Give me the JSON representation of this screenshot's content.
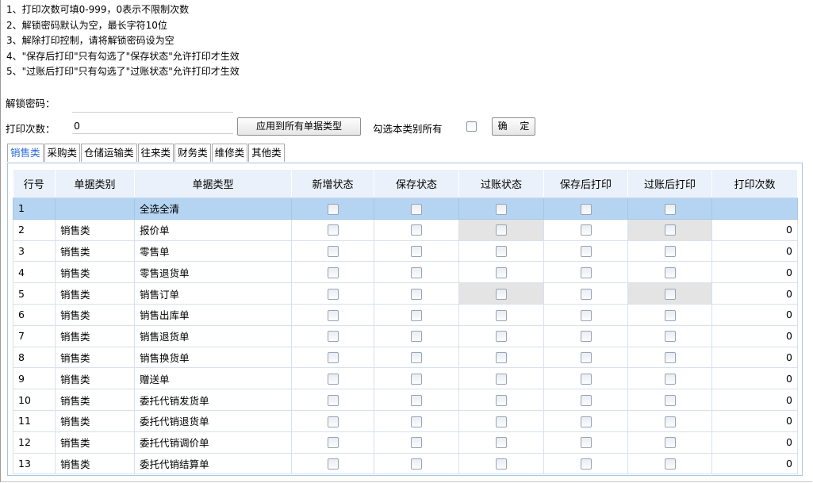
{
  "notes": [
    "1、打印次数可填0-999，0表示不限制次数",
    "2、解锁密码默认为空，最长字符10位",
    "3、解除打印控制，请将解锁密码设为空",
    "4、\"保存后打印\"只有勾选了\"保存状态\"允许打印才生效",
    "5、\"过账后打印\"只有勾选了\"过账状态\"允许打印才生效"
  ],
  "unlock_password": {
    "label": "解锁密码：",
    "value": ""
  },
  "print_count": {
    "label": "打印次数：",
    "value": "0"
  },
  "apply_button": "应用到所有单据类型",
  "select_all_label": "勾选本类别所有",
  "confirm_button": "确 定",
  "tabs": [
    "销售类",
    "采购类",
    "仓储运输类",
    "往来类",
    "财务类",
    "维修类",
    "其他类"
  ],
  "active_tab": 0,
  "table": {
    "headers": [
      "行号",
      "单据类别",
      "单据类型",
      "新增状态",
      "保存状态",
      "过账状态",
      "保存后打印",
      "过账后打印",
      "打印次数"
    ],
    "rows": [
      {
        "no": "1",
        "category": "",
        "type": "全选全清",
        "count": "",
        "selected": true,
        "gray": []
      },
      {
        "no": "2",
        "category": "销售类",
        "type": "报价单",
        "count": "0",
        "selected": false,
        "gray": [
          2,
          4
        ]
      },
      {
        "no": "3",
        "category": "销售类",
        "type": "零售单",
        "count": "0",
        "selected": false,
        "gray": []
      },
      {
        "no": "4",
        "category": "销售类",
        "type": "零售退货单",
        "count": "0",
        "selected": false,
        "gray": []
      },
      {
        "no": "5",
        "category": "销售类",
        "type": "销售订单",
        "count": "0",
        "selected": false,
        "gray": [
          2,
          4
        ]
      },
      {
        "no": "6",
        "category": "销售类",
        "type": "销售出库单",
        "count": "0",
        "selected": false,
        "gray": []
      },
      {
        "no": "7",
        "category": "销售类",
        "type": "销售退货单",
        "count": "0",
        "selected": false,
        "gray": []
      },
      {
        "no": "8",
        "category": "销售类",
        "type": "销售换货单",
        "count": "0",
        "selected": false,
        "gray": []
      },
      {
        "no": "9",
        "category": "销售类",
        "type": "赠送单",
        "count": "0",
        "selected": false,
        "gray": []
      },
      {
        "no": "10",
        "category": "销售类",
        "type": "委托代销发货单",
        "count": "0",
        "selected": false,
        "gray": []
      },
      {
        "no": "11",
        "category": "销售类",
        "type": "委托代销退货单",
        "count": "0",
        "selected": false,
        "gray": []
      },
      {
        "no": "12",
        "category": "销售类",
        "type": "委托代销调价单",
        "count": "0",
        "selected": false,
        "gray": []
      },
      {
        "no": "13",
        "category": "销售类",
        "type": "委托代销结算单",
        "count": "0",
        "selected": false,
        "gray": []
      }
    ]
  }
}
